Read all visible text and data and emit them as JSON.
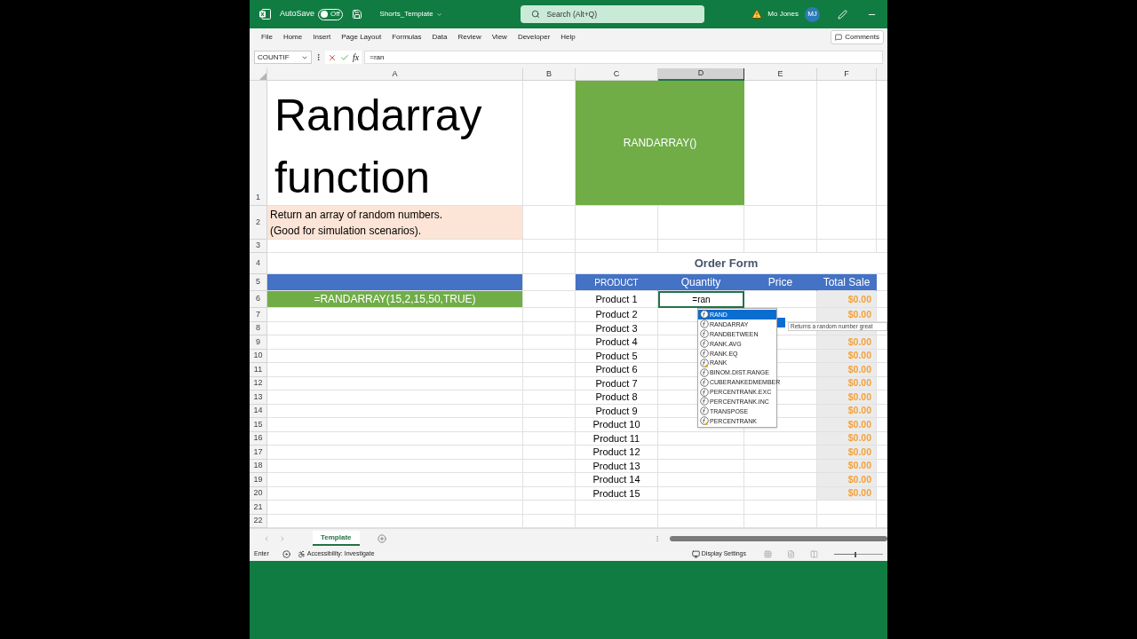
{
  "title_bar": {
    "autosave_label": "AutoSave",
    "autosave_toggle": {
      "label": "Off",
      "on": false
    },
    "filename": "Shorts_Template",
    "search_placeholder": "Search (Alt+Q)",
    "user_name": "Mo Jones",
    "user_initials": "MJ"
  },
  "ribbon_tabs": [
    "File",
    "Home",
    "Insert",
    "Page Layout",
    "Formulas",
    "Data",
    "Review",
    "View",
    "Developer",
    "Help"
  ],
  "comments_button": "Comments",
  "formula_bar": {
    "name_box": "COUNTIF",
    "fx_label": "fx",
    "formula": "=ran"
  },
  "columns": [
    {
      "label": "A",
      "selected": false
    },
    {
      "label": "B",
      "selected": false
    },
    {
      "label": "C",
      "selected": false
    },
    {
      "label": "D",
      "selected": true
    },
    {
      "label": "E",
      "selected": false
    },
    {
      "label": "F",
      "selected": false
    }
  ],
  "row_numbers": [
    "1",
    "2",
    "3",
    "4",
    "5",
    "6",
    "7",
    "8",
    "9",
    "10",
    "11",
    "12",
    "13",
    "14",
    "15",
    "16",
    "17",
    "18",
    "19",
    "20",
    "21",
    "22"
  ],
  "sheet": {
    "title": "Randarray function",
    "description_lines": [
      "Return an array of random numbers.",
      "(Good for simulation scenarios)."
    ],
    "green_box": "RANDARRAY()",
    "formula_display": "=RANDARRAY(15,2,15,50,TRUE)",
    "active_cell_text": "=ran"
  },
  "order_form": {
    "title": "Order Form",
    "headers": [
      "PRODUCT",
      "Quantity",
      "Price",
      "Total Sale"
    ],
    "rows": [
      {
        "product": "Product 1",
        "total": "$0.00"
      },
      {
        "product": "Product 2",
        "total": "$0.00"
      },
      {
        "product": "Product 3"
      },
      {
        "product": "Product 4",
        "total": "$0.00"
      },
      {
        "product": "Product 5",
        "total": "$0.00"
      },
      {
        "product": "Product 6",
        "total": "$0.00"
      },
      {
        "product": "Product 7",
        "total": "$0.00"
      },
      {
        "product": "Product 8",
        "total": "$0.00"
      },
      {
        "product": "Product 9",
        "total": "$0.00"
      },
      {
        "product": "Product 10",
        "total": "$0.00"
      },
      {
        "product": "Product 11",
        "total": "$0.00"
      },
      {
        "product": "Product 12",
        "total": "$0.00"
      },
      {
        "product": "Product 13",
        "total": "$0.00"
      },
      {
        "product": "Product 14",
        "total": "$0.00"
      },
      {
        "product": "Product 15",
        "total": "$0.00"
      }
    ]
  },
  "autocomplete": {
    "items": [
      {
        "label": "RAND",
        "kind": "function",
        "selected": true
      },
      {
        "label": "RANDARRAY",
        "kind": "function",
        "selected": false
      },
      {
        "label": "RANDBETWEEN",
        "kind": "function",
        "selected": false
      },
      {
        "label": "RANK.AVG",
        "kind": "function",
        "selected": false
      },
      {
        "label": "RANK.EQ",
        "kind": "function",
        "selected": false
      },
      {
        "label": "RANK",
        "kind": "compatibility",
        "selected": false
      },
      {
        "label": "BINOM.DIST.RANGE",
        "kind": "function",
        "selected": false
      },
      {
        "label": "CUBERANKEDMEMBER",
        "kind": "function",
        "selected": false
      },
      {
        "label": "PERCENTRANK.EXC",
        "kind": "function",
        "selected": false
      },
      {
        "label": "PERCENTRANK.INC",
        "kind": "function",
        "selected": false
      },
      {
        "label": "TRANSPOSE",
        "kind": "function",
        "selected": false
      },
      {
        "label": "PERCENTRANK",
        "kind": "compatibility",
        "selected": false
      }
    ],
    "tooltip": "Returns a random number great"
  },
  "sheet_tabs": [
    {
      "label": "Template",
      "selected": true
    }
  ],
  "status_bar": {
    "mode": "Enter",
    "accessibility": "Accessibility: Investigate",
    "display_settings": "Display Settings",
    "zoom_slider": {
      "level": 0.45
    }
  }
}
